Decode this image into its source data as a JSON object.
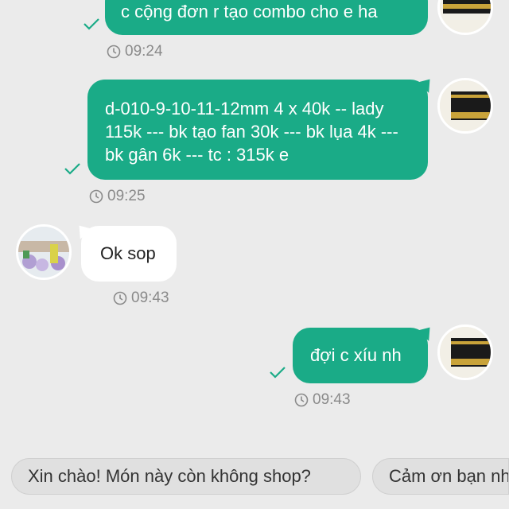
{
  "messages": [
    {
      "text": "c cộng đơn r tạo combo cho e ha",
      "time": "09:24"
    },
    {
      "text": "d-010-9-10-11-12mm 4 x 40k -- lady 115k --- bk tạo fan 30k --- bk lụa 4k --- bk gân 6k --- tc : 315k e",
      "time": "09:25"
    },
    {
      "text": "Ok sop",
      "time": "09:43"
    },
    {
      "text": "đợi c xíu nh",
      "time": "09:43"
    }
  ],
  "quick_replies": [
    "Xin chào! Món này còn không shop?",
    "Cảm ơn bạn nhé"
  ],
  "colors": {
    "outgoing_bubble": "#1aab87",
    "incoming_bubble": "#ffffff",
    "background": "#ebebeb",
    "check": "#1aab87"
  },
  "icons": [
    "clock-icon",
    "check-icon"
  ]
}
